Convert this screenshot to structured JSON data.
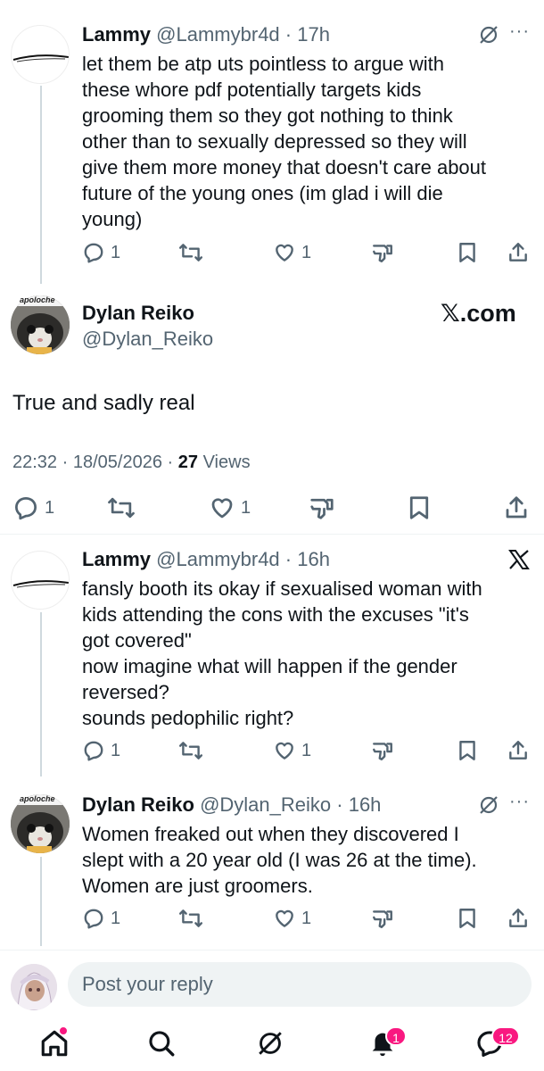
{
  "reply1": {
    "name": "Lammy",
    "handle": "@Lammybr4d",
    "sep": "·",
    "time": "17h",
    "lines": [
      "let them be atp uts pointless to argue with",
      "these whore pdf potentially targets kids",
      "grooming them so they got nothing to think",
      "other than to sexually depressed so they will",
      "give them more money that doesn't care about",
      "future of the young ones (im glad i will die",
      "young)"
    ],
    "reply_count": "1",
    "like_count": "1"
  },
  "main": {
    "avatar_caption": "apoloche",
    "name": "Dylan Reiko",
    "handle": "@Dylan_Reiko",
    "watermark": "𝕏.com",
    "text": "True and sadly real",
    "time": "22:32",
    "date": "18/05/2026",
    "views_count": "27",
    "views_label": "Views",
    "sep": "·",
    "reply_count": "1",
    "like_count": "1"
  },
  "reply2": {
    "name": "Lammy",
    "handle": "@Lammybr4d",
    "sep": "·",
    "time": "16h",
    "lines": [
      "fansly booth its okay if sexualised  woman with",
      "kids attending the cons with the excuses \"it's",
      "got covered\"",
      "now imagine what will happen if the gender",
      "reversed?",
      "sounds pedophilic right?"
    ],
    "reply_count": "1",
    "like_count": "1"
  },
  "reply3": {
    "avatar_caption": "apoloche",
    "name": "Dylan Reiko",
    "handle": "@Dylan_Reiko",
    "sep": "·",
    "time": "16h",
    "lines": [
      "Women freaked out when they discovered I",
      "slept with a 20 year old (I was 26 at the time).",
      "Women are just groomers."
    ],
    "reply_count": "1",
    "like_count": "1"
  },
  "composer": {
    "placeholder": "Post your reply"
  },
  "tabbar": {
    "notifications_badge": "1",
    "messages_badge": "12"
  },
  "colors": {
    "text": "#0f1419",
    "muted": "#536471",
    "badge": "#f91880",
    "divider": "#eff3f4"
  }
}
